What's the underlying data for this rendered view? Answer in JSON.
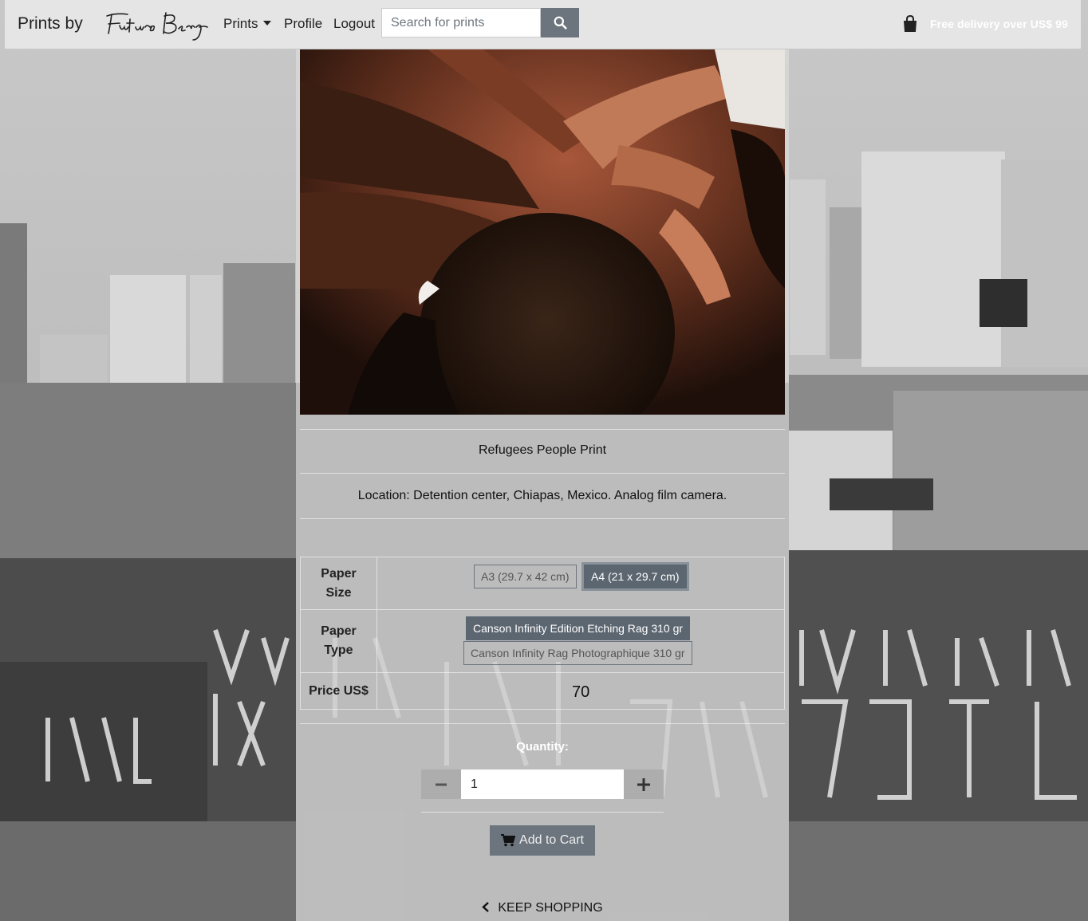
{
  "navbar": {
    "brand": "Prints by",
    "brand_logo": "Futuro Berg",
    "links": {
      "prints": "Prints",
      "profile": "Profile",
      "logout": "Logout"
    },
    "search": {
      "placeholder": "Search for prints",
      "icon": "search-icon"
    },
    "bag_icon": "shopping-bag-icon",
    "delivery_note": "Free delivery over US$ 99"
  },
  "product": {
    "title": "Refugees People Print",
    "description": "Location: Detention center, Chiapas, Mexico. Analog film camera.",
    "options": {
      "paper_size_label": "Paper Size",
      "paper_sizes": [
        "A3 (29.7 x 42 cm)",
        "A4 (21 x 29.7 cm)"
      ],
      "selected_size": "A4 (21 x 29.7 cm)",
      "paper_type_label": "Paper Type",
      "paper_types": [
        "Canson Infinity Edition Etching Rag 310 gr",
        "Canson Infinity Rag Photographique 310 gr"
      ],
      "selected_type": "Canson Infinity Edition Etching Rag 310 gr",
      "price_label": "Price US$",
      "price": "70"
    }
  },
  "quantity": {
    "label": "Quantity:",
    "value": "1",
    "minus_icon": "minus-icon",
    "plus_icon": "plus-icon"
  },
  "cart": {
    "add_label": "Add to Cart",
    "icon": "cart-icon"
  },
  "footer": {
    "keep_shopping": "KEEP SHOPPING",
    "icon": "chevron-left-icon"
  },
  "colors": {
    "button_gray": "#6c757d",
    "selected_gray": "#5c6670",
    "panel_overlay": "#e2e2e2"
  }
}
